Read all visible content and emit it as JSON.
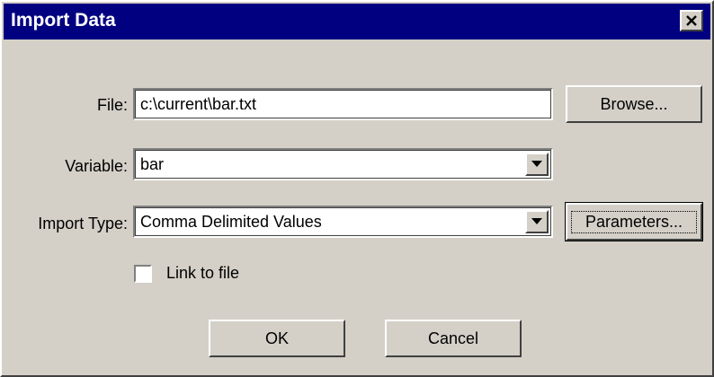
{
  "window": {
    "title": "Import Data",
    "close_icon": "close-icon"
  },
  "form": {
    "file": {
      "label": "File:",
      "value": "c:\\current\\bar.txt"
    },
    "variable": {
      "label": "Variable:",
      "value": "bar"
    },
    "import_type": {
      "label": "Import Type:",
      "value": "Comma Delimited Values"
    },
    "link_to_file": {
      "label": "Link to file",
      "checked": false
    }
  },
  "buttons": {
    "browse": "Browse...",
    "parameters": "Parameters...",
    "ok": "OK",
    "cancel": "Cancel"
  },
  "colors": {
    "titlebar": "#000080",
    "face": "#d4d0c8"
  }
}
